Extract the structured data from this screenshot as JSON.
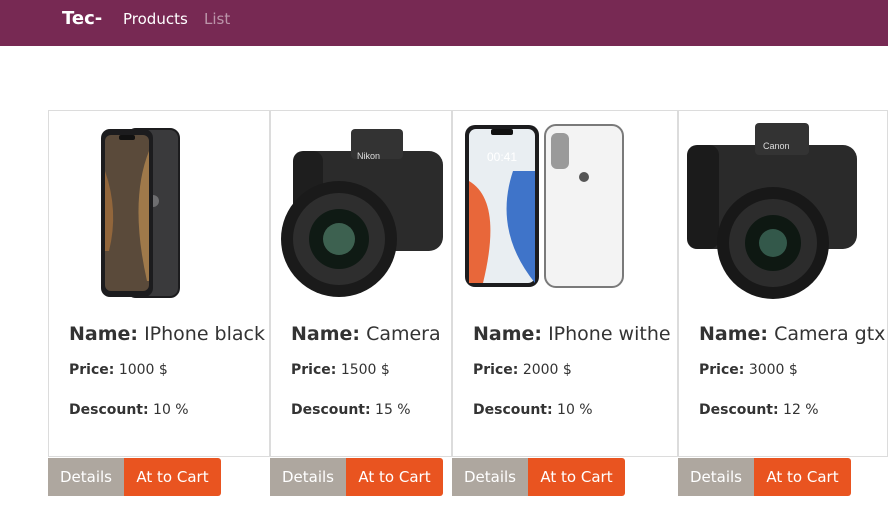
{
  "navbar": {
    "brand": "Tec-",
    "links": [
      {
        "label": "Products"
      },
      {
        "label": "List"
      }
    ]
  },
  "labels": {
    "name": "Name:",
    "price": "Price:",
    "discount": "Descount:",
    "details_button": "Details",
    "cart_button": "At to Cart"
  },
  "products": [
    {
      "name": "IPhone black",
      "price": "1000 $",
      "discount": "10 %",
      "image": "iphone-black-icon"
    },
    {
      "name": "Camera",
      "price": "1500 $",
      "discount": "15 %",
      "image": "nikon-camera-icon"
    },
    {
      "name": "IPhone withe",
      "price": "2000 $",
      "discount": "10 %",
      "image": "iphone-white-icon"
    },
    {
      "name": "Camera gtx",
      "price": "3000 $",
      "discount": "12 %",
      "image": "canon-camera-icon"
    }
  ],
  "colors": {
    "navbar": "#772953",
    "details_button": "#aea79f",
    "cart_button": "#e95420"
  }
}
